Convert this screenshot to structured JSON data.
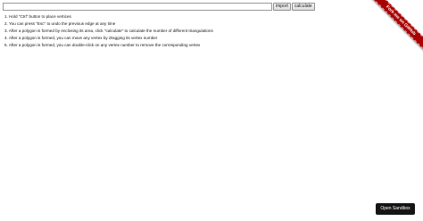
{
  "toolbar": {
    "input_value": "",
    "import_label": "import",
    "calculate_label": "calculate"
  },
  "instructions": [
    "1. Hold \"Ctrl\" button to place vertices",
    "2. You can press \"Esc\" to undo the previous edge at any time",
    "3. After a polygon is formed by enclosing its area, click \"calculate\" to calculate the number of different triangulations",
    "4. After a polygon is formed, you can move any vertex by dragging its vertex number",
    "5. After a polygon is formed, you can double-click on any vertex number to remove the corresponding vertex"
  ],
  "ribbon": {
    "label": "Fork me on GitHub",
    "color": "#aa0000"
  },
  "sandbox_button": {
    "label": "Open Sandbox"
  }
}
